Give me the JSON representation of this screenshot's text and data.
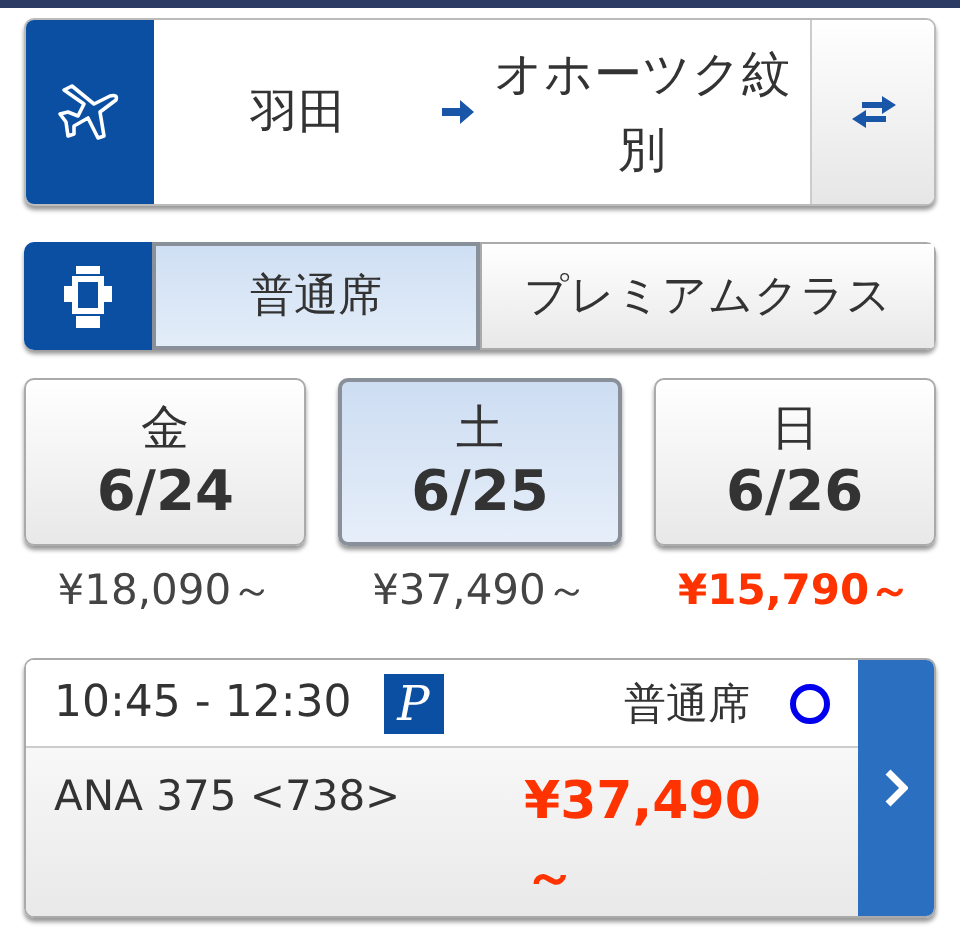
{
  "route": {
    "origin": "羽田",
    "destination": "オホーツク紋別"
  },
  "seat_classes": [
    {
      "label": "普通席",
      "selected": true
    },
    {
      "label": "プレミアムクラス",
      "selected": false
    }
  ],
  "dates": [
    {
      "weekday": "金",
      "date": "6/24",
      "price": "¥18,090～",
      "selected": false,
      "cheapest": false
    },
    {
      "weekday": "土",
      "date": "6/25",
      "price": "¥37,490～",
      "selected": true,
      "cheapest": false
    },
    {
      "weekday": "日",
      "date": "6/26",
      "price": "¥15,790～",
      "selected": false,
      "cheapest": true
    }
  ],
  "flight": {
    "time": "10:45 - 12:30",
    "badge": "P",
    "seat_class": "普通席",
    "flight_number": "ANA 375 <738>",
    "price": "¥37,490～"
  }
}
